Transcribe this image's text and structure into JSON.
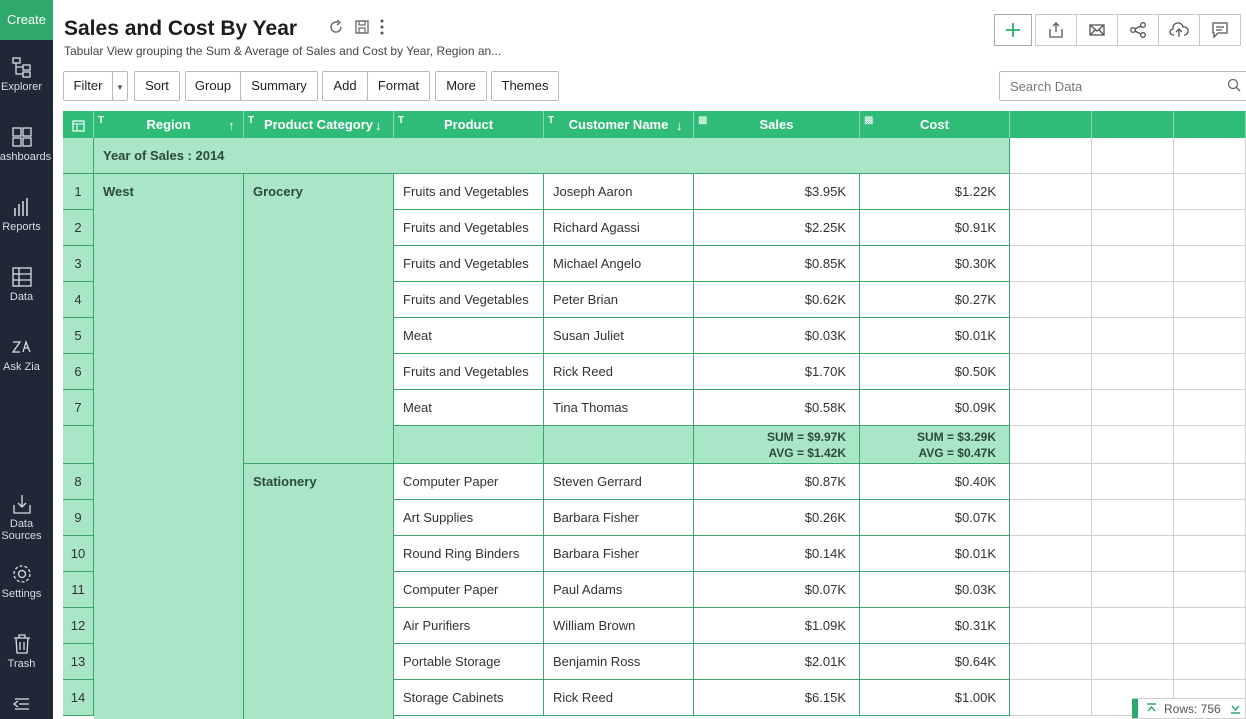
{
  "sidebar": {
    "create_label": "Create",
    "items": [
      {
        "label": "Explorer",
        "icon": "explorer-icon"
      },
      {
        "label": "Dashboards",
        "icon": "dashboards-icon"
      },
      {
        "label": "Reports",
        "icon": "reports-icon"
      },
      {
        "label": "Data",
        "icon": "data-icon"
      },
      {
        "label": "Ask Zia",
        "icon": "zia-icon"
      },
      {
        "label": "Data Sources",
        "icon": "data-sources-icon"
      },
      {
        "label": "Settings",
        "icon": "gear-icon"
      },
      {
        "label": "Trash",
        "icon": "trash-icon"
      }
    ],
    "collapse_icon": "collapse-menu-icon"
  },
  "header": {
    "title": "Sales and Cost By Year",
    "description": "Tabular View grouping the Sum & Average of Sales and Cost by Year, Region an..."
  },
  "toolbar": {
    "filter": "Filter",
    "sort": "Sort",
    "group": "Group",
    "summary": "Summary",
    "add": "Add",
    "format": "Format",
    "more": "More",
    "themes": "Themes",
    "search_placeholder": "Search Data"
  },
  "columns": {
    "region": "Region",
    "product_category": "Product Category",
    "product": "Product",
    "customer_name": "Customer Name",
    "sales": "Sales",
    "cost": "Cost"
  },
  "group": {
    "year_label": "Year of Sales : 2014",
    "region": "West",
    "category1": "Grocery",
    "category2": "Stationery",
    "subtotal_sales_sum": "SUM = $9.97K",
    "subtotal_sales_avg": "AVG = $1.42K",
    "subtotal_cost_sum": "SUM = $3.29K",
    "subtotal_cost_avg": "AVG = $0.47K"
  },
  "rows": [
    {
      "n": "1",
      "product": "Fruits and Vegetables",
      "customer": "Joseph Aaron",
      "sales": "$3.95K",
      "cost": "$1.22K"
    },
    {
      "n": "2",
      "product": "Fruits and Vegetables",
      "customer": "Richard Agassi",
      "sales": "$2.25K",
      "cost": "$0.91K"
    },
    {
      "n": "3",
      "product": "Fruits and Vegetables",
      "customer": "Michael Angelo",
      "sales": "$0.85K",
      "cost": "$0.30K"
    },
    {
      "n": "4",
      "product": "Fruits and Vegetables",
      "customer": "Peter Brian",
      "sales": "$0.62K",
      "cost": "$0.27K"
    },
    {
      "n": "5",
      "product": "Meat",
      "customer": "Susan Juliet",
      "sales": "$0.03K",
      "cost": "$0.01K"
    },
    {
      "n": "6",
      "product": "Fruits and Vegetables",
      "customer": "Rick Reed",
      "sales": "$1.70K",
      "cost": "$0.50K"
    },
    {
      "n": "7",
      "product": "Meat",
      "customer": "Tina Thomas",
      "sales": "$0.58K",
      "cost": "$0.09K"
    },
    {
      "n": "8",
      "product": "Computer Paper",
      "customer": "Steven Gerrard",
      "sales": "$0.87K",
      "cost": "$0.40K"
    },
    {
      "n": "9",
      "product": "Art Supplies",
      "customer": "Barbara Fisher",
      "sales": "$0.26K",
      "cost": "$0.07K"
    },
    {
      "n": "10",
      "product": "Round Ring Binders",
      "customer": "Barbara Fisher",
      "sales": "$0.14K",
      "cost": "$0.01K"
    },
    {
      "n": "11",
      "product": "Computer Paper",
      "customer": "Paul Adams",
      "sales": "$0.07K",
      "cost": "$0.03K"
    },
    {
      "n": "12",
      "product": "Air Purifiers",
      "customer": "William Brown",
      "sales": "$1.09K",
      "cost": "$0.31K"
    },
    {
      "n": "13",
      "product": "Portable Storage",
      "customer": "Benjamin Ross",
      "sales": "$2.01K",
      "cost": "$0.64K"
    },
    {
      "n": "14",
      "product": "Storage Cabinets",
      "customer": "Rick Reed",
      "sales": "$6.15K",
      "cost": "$1.00K"
    }
  ],
  "footer": {
    "rows_label": "Rows: 756"
  },
  "colors": {
    "accent": "#2fbc78",
    "group_fill": "#a8e6c6",
    "sidebar_bg": "#1f2836",
    "create_bg": "#2fa96b"
  }
}
